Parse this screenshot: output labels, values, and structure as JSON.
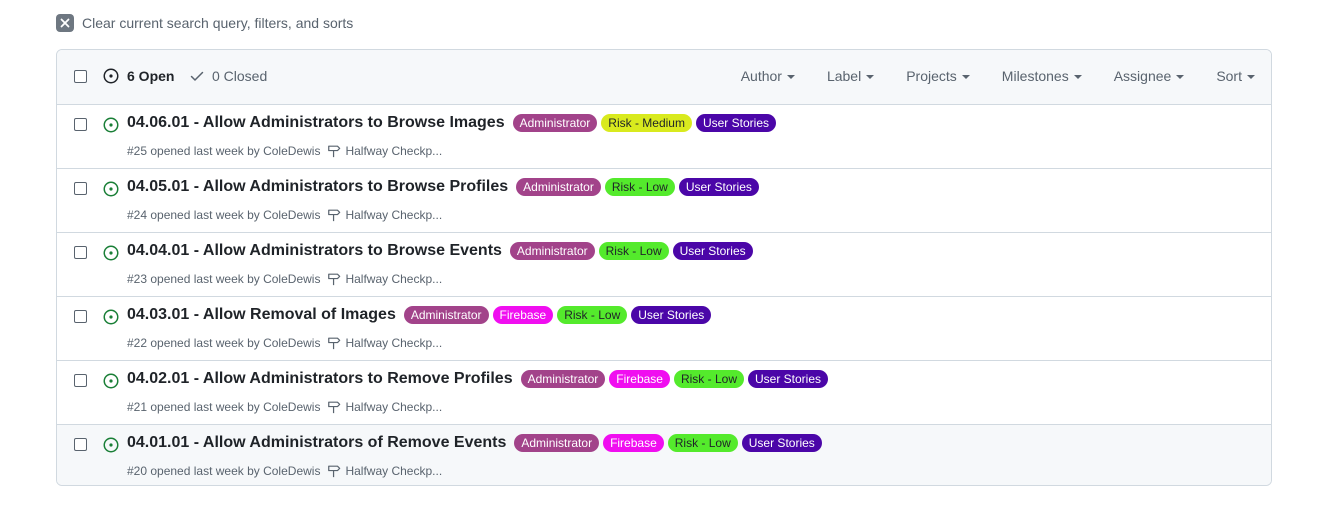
{
  "clear_filters": {
    "label": "Clear current search query, filters, and sorts",
    "icon": "close-icon"
  },
  "header": {
    "open_label": "6 Open",
    "closed_label": "0 Closed",
    "filters": [
      {
        "label": "Author"
      },
      {
        "label": "Label"
      },
      {
        "label": "Projects"
      },
      {
        "label": "Milestones"
      },
      {
        "label": "Assignee"
      },
      {
        "label": "Sort"
      }
    ]
  },
  "colors": {
    "open_green": "#1a7f37",
    "label_administrator": "#a2438a",
    "label_risk_medium": "#d9ea1e",
    "label_risk_low": "#54ea2c",
    "label_user_stories": "#4b06a8",
    "label_firebase": "#f00ef0"
  },
  "issues": [
    {
      "title": "04.06.01 - Allow Administrators to Browse Images",
      "labels": [
        {
          "text": "Administrator",
          "bg": "#a2438a",
          "fg": "#ffffff"
        },
        {
          "text": "Risk - Medium",
          "bg": "#d9ea1e",
          "fg": "#1f2328"
        },
        {
          "text": "User Stories",
          "bg": "#4b06a8",
          "fg": "#ffffff"
        }
      ],
      "meta": "#25 opened last week by ColeDewis",
      "milestone": "Halfway Checkp..."
    },
    {
      "title": "04.05.01 - Allow Administrators to Browse Profiles",
      "labels": [
        {
          "text": "Administrator",
          "bg": "#a2438a",
          "fg": "#ffffff"
        },
        {
          "text": "Risk - Low",
          "bg": "#54ea2c",
          "fg": "#1f2328"
        },
        {
          "text": "User Stories",
          "bg": "#4b06a8",
          "fg": "#ffffff"
        }
      ],
      "meta": "#24 opened last week by ColeDewis",
      "milestone": "Halfway Checkp..."
    },
    {
      "title": "04.04.01 - Allow Administrators to Browse Events",
      "labels": [
        {
          "text": "Administrator",
          "bg": "#a2438a",
          "fg": "#ffffff"
        },
        {
          "text": "Risk - Low",
          "bg": "#54ea2c",
          "fg": "#1f2328"
        },
        {
          "text": "User Stories",
          "bg": "#4b06a8",
          "fg": "#ffffff"
        }
      ],
      "meta": "#23 opened last week by ColeDewis",
      "milestone": "Halfway Checkp..."
    },
    {
      "title": "04.03.01 - Allow Removal of Images",
      "labels": [
        {
          "text": "Administrator",
          "bg": "#a2438a",
          "fg": "#ffffff"
        },
        {
          "text": "Firebase",
          "bg": "#f00ef0",
          "fg": "#ffffff"
        },
        {
          "text": "Risk - Low",
          "bg": "#54ea2c",
          "fg": "#1f2328"
        },
        {
          "text": "User Stories",
          "bg": "#4b06a8",
          "fg": "#ffffff"
        }
      ],
      "meta": "#22 opened last week by ColeDewis",
      "milestone": "Halfway Checkp..."
    },
    {
      "title": "04.02.01 - Allow Administrators to Remove Profiles",
      "labels": [
        {
          "text": "Administrator",
          "bg": "#a2438a",
          "fg": "#ffffff"
        },
        {
          "text": "Firebase",
          "bg": "#f00ef0",
          "fg": "#ffffff"
        },
        {
          "text": "Risk - Low",
          "bg": "#54ea2c",
          "fg": "#1f2328"
        },
        {
          "text": "User Stories",
          "bg": "#4b06a8",
          "fg": "#ffffff"
        }
      ],
      "meta": "#21 opened last week by ColeDewis",
      "milestone": "Halfway Checkp..."
    },
    {
      "title": "04.01.01 - Allow Administrators of Remove Events",
      "labels": [
        {
          "text": "Administrator",
          "bg": "#a2438a",
          "fg": "#ffffff"
        },
        {
          "text": "Firebase",
          "bg": "#f00ef0",
          "fg": "#ffffff"
        },
        {
          "text": "Risk - Low",
          "bg": "#54ea2c",
          "fg": "#1f2328"
        },
        {
          "text": "User Stories",
          "bg": "#4b06a8",
          "fg": "#ffffff"
        }
      ],
      "meta": "#20 opened last week by ColeDewis",
      "milestone": "Halfway Checkp..."
    }
  ]
}
